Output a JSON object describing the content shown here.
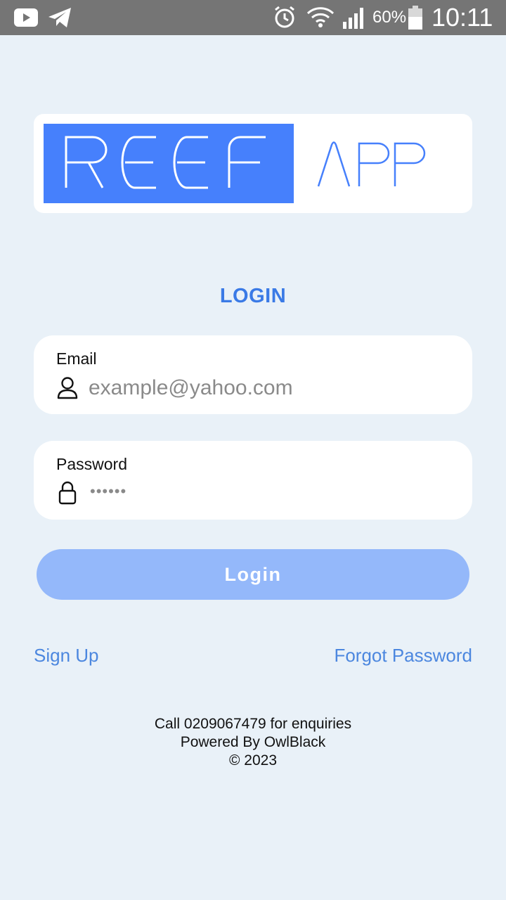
{
  "status_bar": {
    "battery_percent": "60%",
    "time": "10:11",
    "icons": [
      "youtube-icon",
      "telegram-icon",
      "alarm-icon",
      "wifi-icon",
      "signal-icon",
      "battery-icon"
    ]
  },
  "logo": {
    "word_left": "REEF",
    "word_right": "APP",
    "colors": {
      "block": "#4680fc",
      "text_on_block": "#ffffff",
      "text_right": "#4680fc"
    }
  },
  "heading": "LOGIN",
  "email": {
    "label": "Email",
    "placeholder": "example@yahoo.com",
    "icon": "user-icon"
  },
  "password": {
    "label": "Password",
    "value": "••••••",
    "icon": "lock-icon"
  },
  "login_button": "Login",
  "links": {
    "sign_up": "Sign Up",
    "forgot_password": "Forgot Password"
  },
  "footer": {
    "contact": "Call 0209067479 for enquiries",
    "powered_by": "Powered By OwlBlack",
    "copyright": "© 2023"
  },
  "colors": {
    "background": "#e9f1f8",
    "accent": "#3a7ae6",
    "button_disabled": "#94b8fa",
    "status_bar": "#757575"
  }
}
